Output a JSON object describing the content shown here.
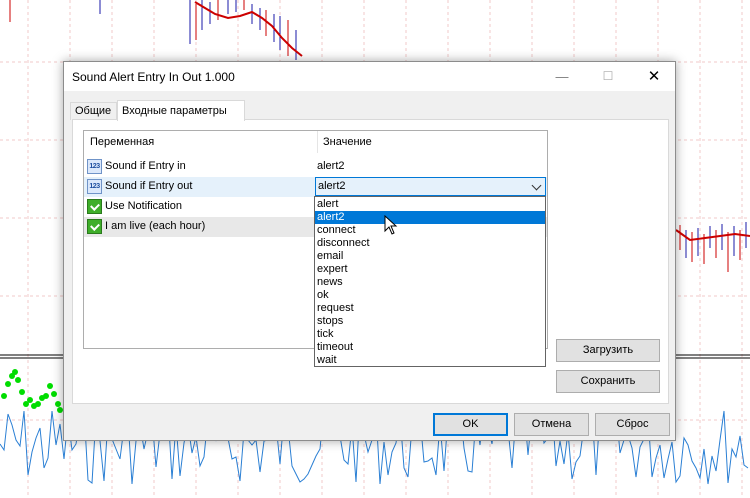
{
  "window": {
    "title": "Sound Alert Entry In Out 1.000",
    "minimize_icon": "minimize-icon",
    "maximize_icon": "maximize-icon",
    "close_icon": "close-icon"
  },
  "tabs": [
    {
      "label": "Общие"
    },
    {
      "label": "Входные параметры"
    }
  ],
  "table": {
    "col_variable": "Переменная",
    "col_value": "Значение",
    "rows": [
      {
        "icon": "number-icon",
        "icon_text": "123",
        "name": "Sound if Entry in",
        "value": "alert2"
      },
      {
        "icon": "number-icon",
        "icon_text": "123",
        "name": "Sound if Entry out",
        "value": "alert2"
      },
      {
        "icon": "bool-icon",
        "name": "Use Notification",
        "value": ""
      },
      {
        "icon": "bool-icon",
        "name": "I am live (each hour)",
        "value": ""
      }
    ]
  },
  "dropdown": {
    "selected": "alert2",
    "options": [
      "alert",
      "alert2",
      "connect",
      "disconnect",
      "email",
      "expert",
      "news",
      "ok",
      "request",
      "stops",
      "tick",
      "timeout",
      "wait"
    ]
  },
  "buttons": {
    "load": "Загрузить",
    "save": "Сохранить",
    "ok": "OK",
    "cancel": "Отмена",
    "reset": "Сброс"
  },
  "colors": {
    "accent": "#0078d7",
    "bear_line": "#cc0000",
    "bar_color": "#1a1aa8",
    "indicator_dots": "#00dd00",
    "oscillator": "#2a7fd4"
  }
}
